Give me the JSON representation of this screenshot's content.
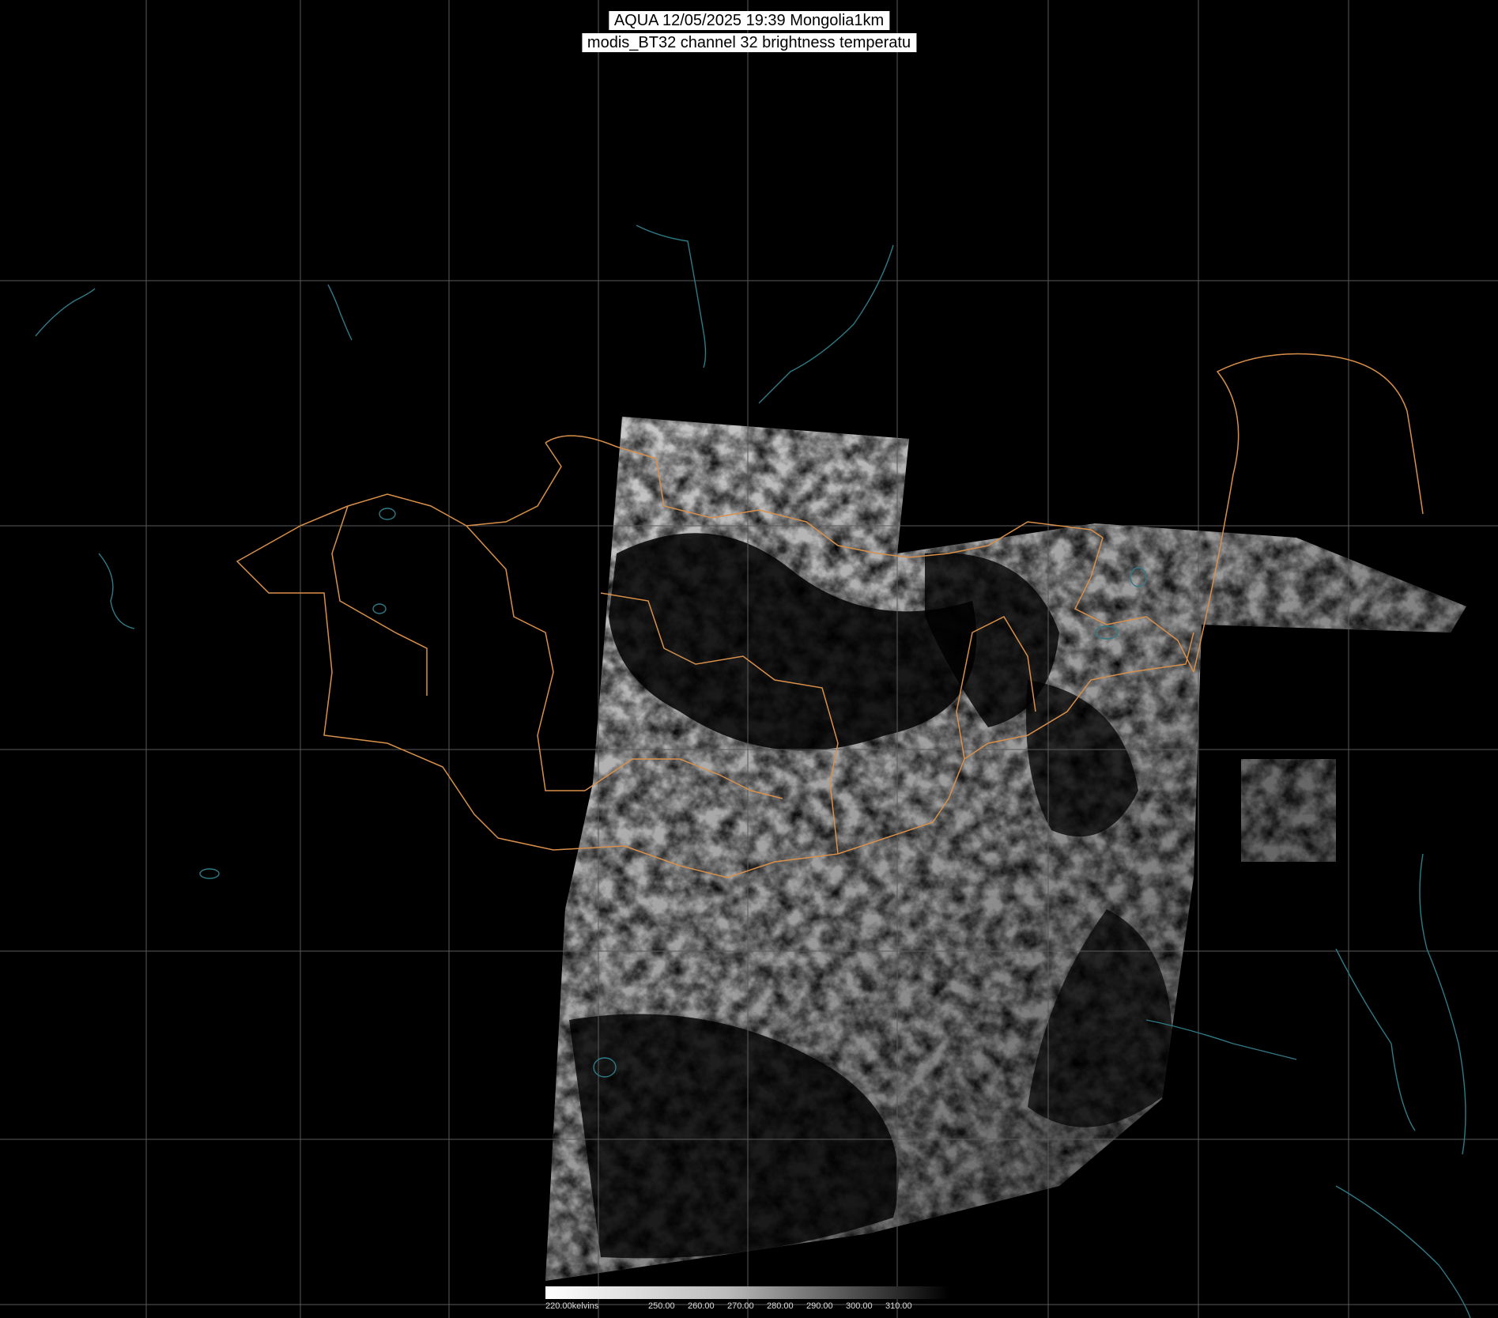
{
  "title": {
    "line1": "AQUA 12/05/2025 19:39 Mongolia1km",
    "line2": "modis_BT32 channel 32 brightness temperatu"
  },
  "colorbar": {
    "labels": [
      "220.00kelvins",
      "250.00",
      "260.00",
      "270.00",
      "280.00",
      "290.00",
      "300.00",
      "310.00"
    ]
  },
  "colors": {
    "background": "#000000",
    "grid": "#5a5a5a",
    "province_borders": "#d9904a",
    "coastlines": "#2f7a86",
    "title_box": "#ffffff"
  }
}
